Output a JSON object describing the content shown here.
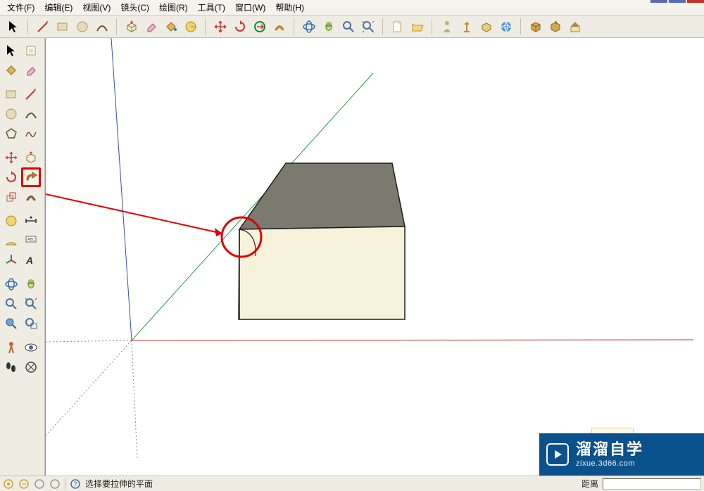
{
  "menu": {
    "file": "文件(F)",
    "edit": "编辑(E)",
    "view": "视图(V)",
    "camera": "镜头(C)",
    "draw": "绘图(R)",
    "tools": "工具(T)",
    "window": "窗口(W)",
    "help": "帮助(H)"
  },
  "status": {
    "message": "选择要拉伸的平面",
    "distance_label": "距离"
  },
  "watermark": {
    "title": "溜溜自学",
    "subtitle": "zixue.3d66.com"
  },
  "icons": {
    "select": "select-icon",
    "line": "line-icon",
    "rectangle": "rectangle-icon",
    "circle": "circle-icon",
    "arc": "arc-icon",
    "pushpull": "pushpull-icon",
    "eraser": "eraser-icon",
    "paint": "paint-icon",
    "explode": "explode-icon",
    "move": "move-icon",
    "rotate": "rotate-icon",
    "scale": "scale-icon",
    "offset": "offset-icon",
    "followme": "followme-icon",
    "orbit": "orbit-icon",
    "pan": "pan-icon",
    "zoom": "zoom-icon",
    "zoomext": "zoomext-icon",
    "new": "new-icon",
    "open": "open-icon",
    "save": "save-icon",
    "undo": "undo-icon",
    "redo": "redo-icon",
    "tape": "tape-icon",
    "text": "text-icon",
    "dimension": "dimension-icon",
    "axes": "axes-icon",
    "walk": "walk-icon",
    "look": "look-icon",
    "section": "section-icon",
    "3dwarehouse": "3dwh-icon",
    "component": "component-icon",
    "model": "model-icon",
    "package": "package-icon",
    "home": "home-icon",
    "survey": "survey-icon"
  }
}
